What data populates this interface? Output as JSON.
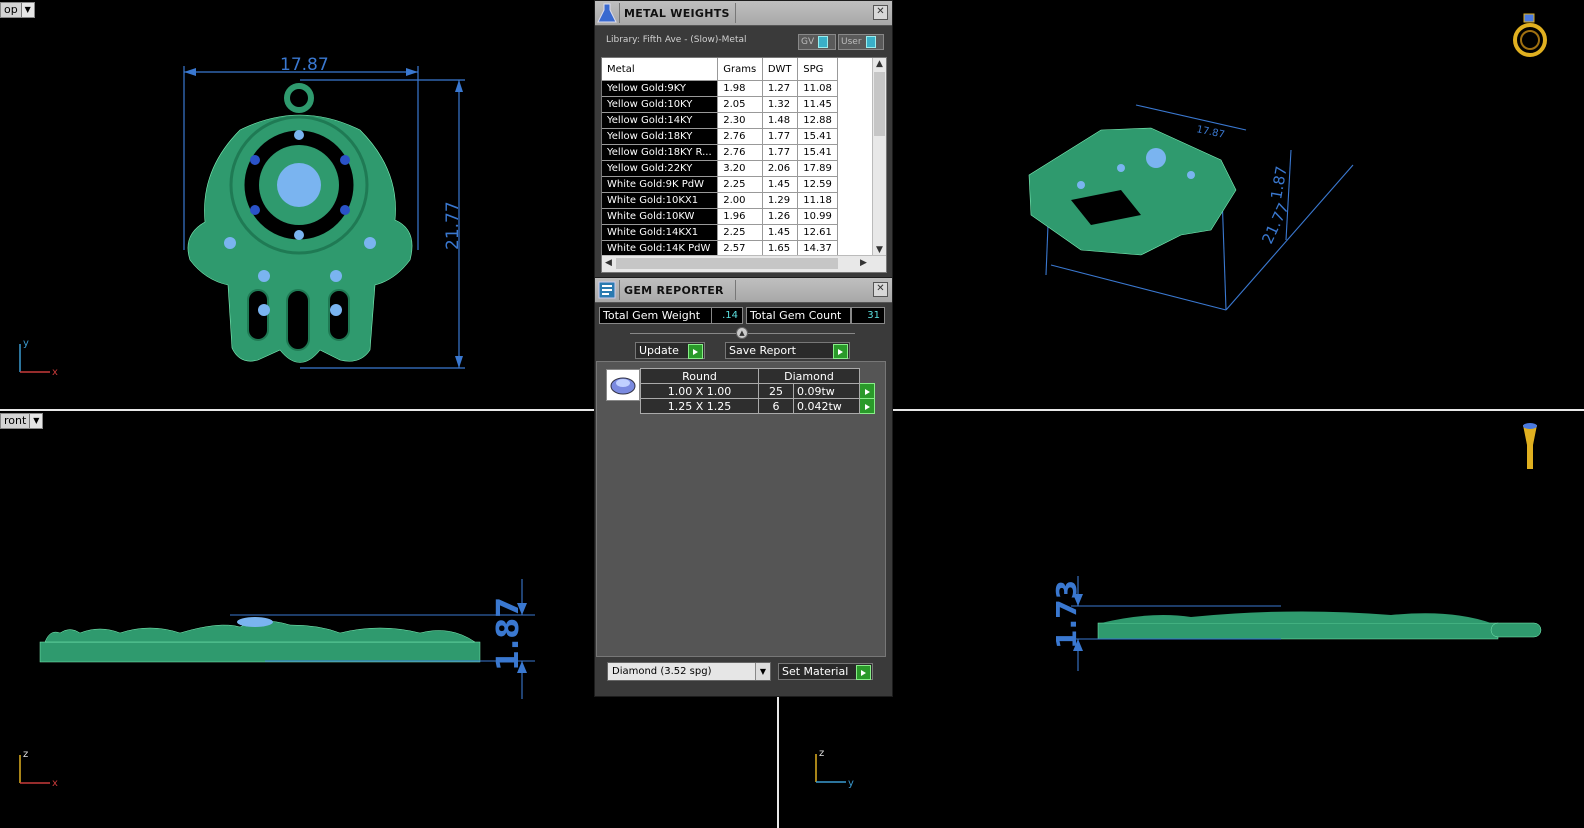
{
  "viewports": {
    "top": {
      "label": "op",
      "dim_width": "17.87",
      "dim_height": "21.77",
      "axis_v": "y",
      "axis_h": "x"
    },
    "front": {
      "label": "ront",
      "dim_height": "1.87",
      "axis_v": "z",
      "axis_h": "x"
    },
    "perspective": {
      "dim_a": "17.87",
      "dim_b": "1.87",
      "dim_c": "21.77"
    },
    "right": {
      "dim_height": "1.73",
      "axis_v": "z",
      "axis_h": "y"
    }
  },
  "metal_weights": {
    "title": "METAL WEIGHTS",
    "library": "Library: Fifth Ave - (Slow)-Metal",
    "toggle_gv": "GV",
    "toggle_user": "User",
    "columns": [
      "Metal",
      "Grams",
      "DWT",
      "SPG"
    ],
    "rows": [
      [
        "Yellow Gold:9KY",
        "1.98",
        "1.27",
        "11.08"
      ],
      [
        "Yellow Gold:10KY",
        "2.05",
        "1.32",
        "11.45"
      ],
      [
        "Yellow Gold:14KY",
        "2.30",
        "1.48",
        "12.88"
      ],
      [
        "Yellow Gold:18KY",
        "2.76",
        "1.77",
        "15.41"
      ],
      [
        "Yellow Gold:18KY R...",
        "2.76",
        "1.77",
        "15.41"
      ],
      [
        "Yellow Gold:22KY",
        "3.20",
        "2.06",
        "17.89"
      ],
      [
        "White Gold:9K PdW",
        "2.25",
        "1.45",
        "12.59"
      ],
      [
        "White Gold:10KX1",
        "2.00",
        "1.29",
        "11.18"
      ],
      [
        "White Gold:10KW",
        "1.96",
        "1.26",
        "10.99"
      ],
      [
        "White Gold:14KX1",
        "2.25",
        "1.45",
        "12.61"
      ],
      [
        "White Gold:14K PdW",
        "2.57",
        "1.65",
        "14.37"
      ]
    ]
  },
  "gem_reporter": {
    "title": "GEM REPORTER",
    "total_weight_label": "Total Gem Weight",
    "total_weight_value": ".14",
    "total_count_label": "Total Gem Count",
    "total_count_value": "31",
    "update_label": "Update",
    "save_label": "Save Report",
    "shape_header": "Round",
    "material_header": "Diamond",
    "gems": [
      {
        "size": "1.00 X 1.00",
        "count": "25",
        "weight": "0.09tw"
      },
      {
        "size": "1.25 X 1.25",
        "count": "6",
        "weight": "0.042tw"
      }
    ],
    "material_select": "Diamond     (3.52 spg)",
    "set_material_label": "Set Material"
  },
  "colors": {
    "model": "#2f9a6e",
    "dim": "#3a78d0",
    "accent_green": "#2a9a2a",
    "stone": "#7ab4f0"
  }
}
